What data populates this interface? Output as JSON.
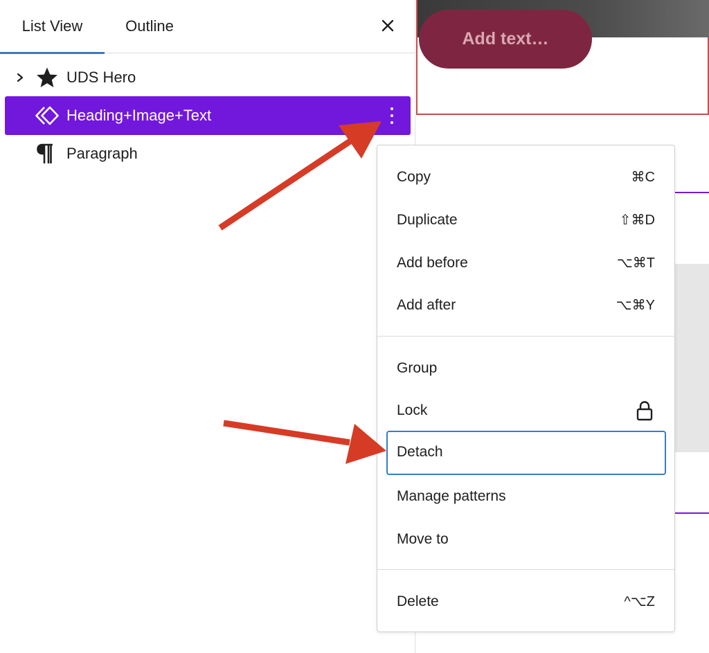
{
  "tabs": {
    "list_view": "List View",
    "outline": "Outline"
  },
  "tree": [
    {
      "label": "UDS Hero",
      "icon": "star-icon"
    },
    {
      "label": "Heading+Image+Text",
      "icon": "pattern-diamond-icon",
      "selected": true
    },
    {
      "label": "Paragraph",
      "icon": "pilcrow-icon"
    }
  ],
  "canvas": {
    "hero_button": "Add text…"
  },
  "menu": {
    "copy": {
      "label": "Copy",
      "shortcut": "⌘C"
    },
    "duplicate": {
      "label": "Duplicate",
      "shortcut": "⇧⌘D"
    },
    "add_before": {
      "label": "Add before",
      "shortcut": "⌥⌘T"
    },
    "add_after": {
      "label": "Add after",
      "shortcut": "⌥⌘Y"
    },
    "group": {
      "label": "Group"
    },
    "lock": {
      "label": "Lock",
      "icon": "lock-icon"
    },
    "detach": {
      "label": "Detach"
    },
    "manage_patterns": {
      "label": "Manage patterns"
    },
    "move_to": {
      "label": "Move to"
    },
    "delete": {
      "label": "Delete",
      "shortcut": "^⌥Z"
    }
  },
  "colors": {
    "selection": "#7218dd",
    "tab_underline": "#3a7bbf",
    "focus_outline": "#3a7bbf",
    "annotation_arrow": "#d63b26",
    "hero_button": "#7e2641"
  }
}
